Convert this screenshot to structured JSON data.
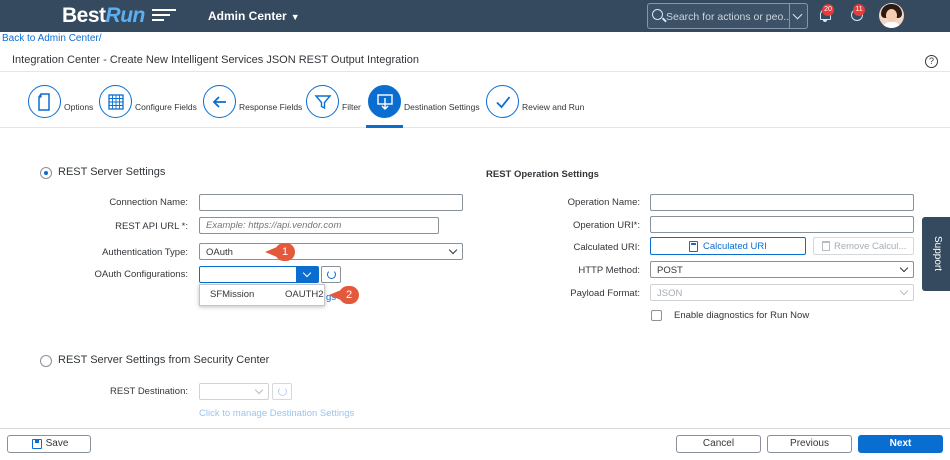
{
  "shell": {
    "logo_best": "Best",
    "logo_run": "Run",
    "app_menu": "Admin Center",
    "search_placeholder": "Search for actions or peo...",
    "notifications_count": "20",
    "approvals_count": "11"
  },
  "breadcrumb": {
    "back": "Back to Admin Center/"
  },
  "page": {
    "title": "Integration Center - Create New Intelligent Services JSON REST Output Integration",
    "help": "?"
  },
  "steps": [
    {
      "label": "Options",
      "icon": "document-icon",
      "active": false
    },
    {
      "label": "Configure Fields",
      "icon": "table-grid-icon",
      "active": false
    },
    {
      "label": "Response Fields",
      "icon": "arrow-left-icon",
      "active": false
    },
    {
      "label": "Filter",
      "icon": "filter-icon",
      "active": false
    },
    {
      "label": "Destination Settings",
      "icon": "destination-icon",
      "active": true
    },
    {
      "label": "Review and Run",
      "icon": "checkmark-icon",
      "active": false
    }
  ],
  "rest_server": {
    "title": "REST Server Settings",
    "connection_name_label": "Connection Name:",
    "connection_name_value": "",
    "api_url_label": "REST API URL *:",
    "api_url_placeholder": "Example: https://api.vendor.com",
    "auth_type_label": "Authentication Type:",
    "auth_type_value": "OAuth",
    "oauth_config_label": "OAuth Configurations:",
    "oauth_config_value": "",
    "dropdown_options": [
      "SFMission",
      "OAUTH2"
    ],
    "peek_text": "gs"
  },
  "security_center": {
    "title": "REST Server Settings from Security Center",
    "destination_label": "REST Destination:",
    "destination_value": "",
    "manage_link": "Click to manage Destination Settings"
  },
  "operation": {
    "title": "REST Operation Settings",
    "op_name_label": "Operation Name:",
    "op_name_value": "",
    "op_uri_label": "Operation URI*:",
    "op_uri_value": "",
    "calc_uri_label": "Calculated URI:",
    "calc_button": "Calculated URI",
    "remove_button": "Remove Calcul...",
    "http_method_label": "HTTP Method:",
    "http_method_value": "POST",
    "payload_label": "Payload Format:",
    "payload_value": "JSON",
    "diagnostics_label": "Enable diagnostics for Run Now"
  },
  "callouts": [
    "1",
    "2"
  ],
  "support": "Support",
  "footer": {
    "save": "Save",
    "cancel": "Cancel",
    "previous": "Previous",
    "next": "Next"
  },
  "colors": {
    "shell_bg": "#354a5f",
    "accent": "#0a6ed1",
    "callout": "#e4583c",
    "badge": "#e53b3b"
  }
}
